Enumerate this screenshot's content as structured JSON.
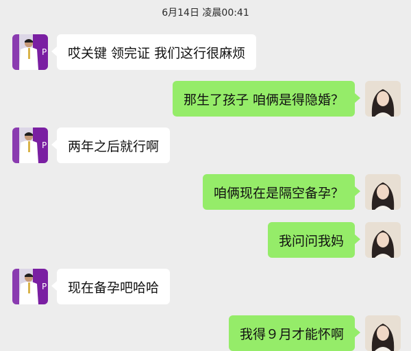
{
  "chat": {
    "timestamp": "6月14日 凌晨00:41",
    "messages": [
      {
        "sender": "other",
        "text": "哎关键 领完证  我们这行很麻烦"
      },
      {
        "sender": "self",
        "text": "那生了孩子 咱俩是得隐婚？"
      },
      {
        "sender": "other",
        "text": "两年之后就行啊"
      },
      {
        "sender": "self",
        "text": "咱俩现在是隔空备孕？"
      },
      {
        "sender": "self",
        "text": "我问问我妈"
      },
      {
        "sender": "other",
        "text": "现在备孕吧哈哈"
      },
      {
        "sender": "self",
        "text": "我得９月才能怀啊"
      }
    ]
  },
  "avatars": {
    "other": {
      "icon": "man-in-white-shirt-avatar",
      "accent": "#7a1fa2",
      "badge": "P"
    },
    "self": {
      "icon": "woman-with-long-hair-avatar"
    }
  },
  "colors": {
    "background": "#ededed",
    "bubble_self": "#95ec69",
    "bubble_other": "#ffffff"
  }
}
